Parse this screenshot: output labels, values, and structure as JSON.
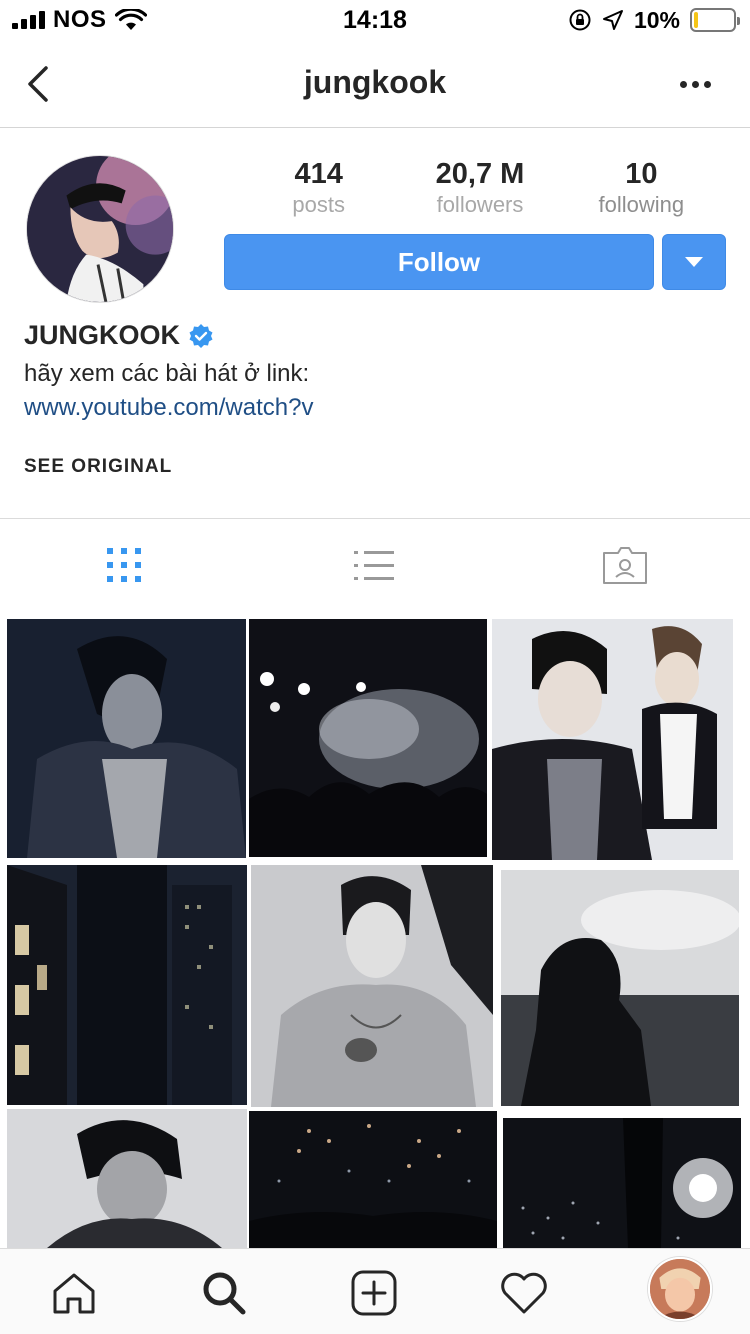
{
  "status_bar": {
    "carrier": "NOS",
    "time": "14:18",
    "battery_percent": "10%",
    "battery_level": 0.1
  },
  "header": {
    "title": "jungkook"
  },
  "profile": {
    "stats": [
      {
        "value": "414",
        "label": "posts"
      },
      {
        "value": "20,7 M",
        "label": "followers"
      },
      {
        "value": "10",
        "label": "following"
      }
    ],
    "follow_label": "Follow",
    "name": "JUNGKOOK",
    "bio": "hãy xem các bài hát ở link:",
    "link": "www.youtube.com/watch?v",
    "see_original": "SEE ORIGINAL"
  },
  "colors": {
    "accent": "#4a95f1",
    "verified": "#3897f0",
    "link": "#1f4e85"
  },
  "icons": {
    "back": "chevron-left-icon",
    "more": "more-icon",
    "grid": "grid-icon",
    "list": "list-icon",
    "tagged": "tagged-icon",
    "home": "home-icon",
    "search": "search-icon",
    "add": "add-post-icon",
    "activity": "heart-icon",
    "profile": "profile-avatar"
  }
}
